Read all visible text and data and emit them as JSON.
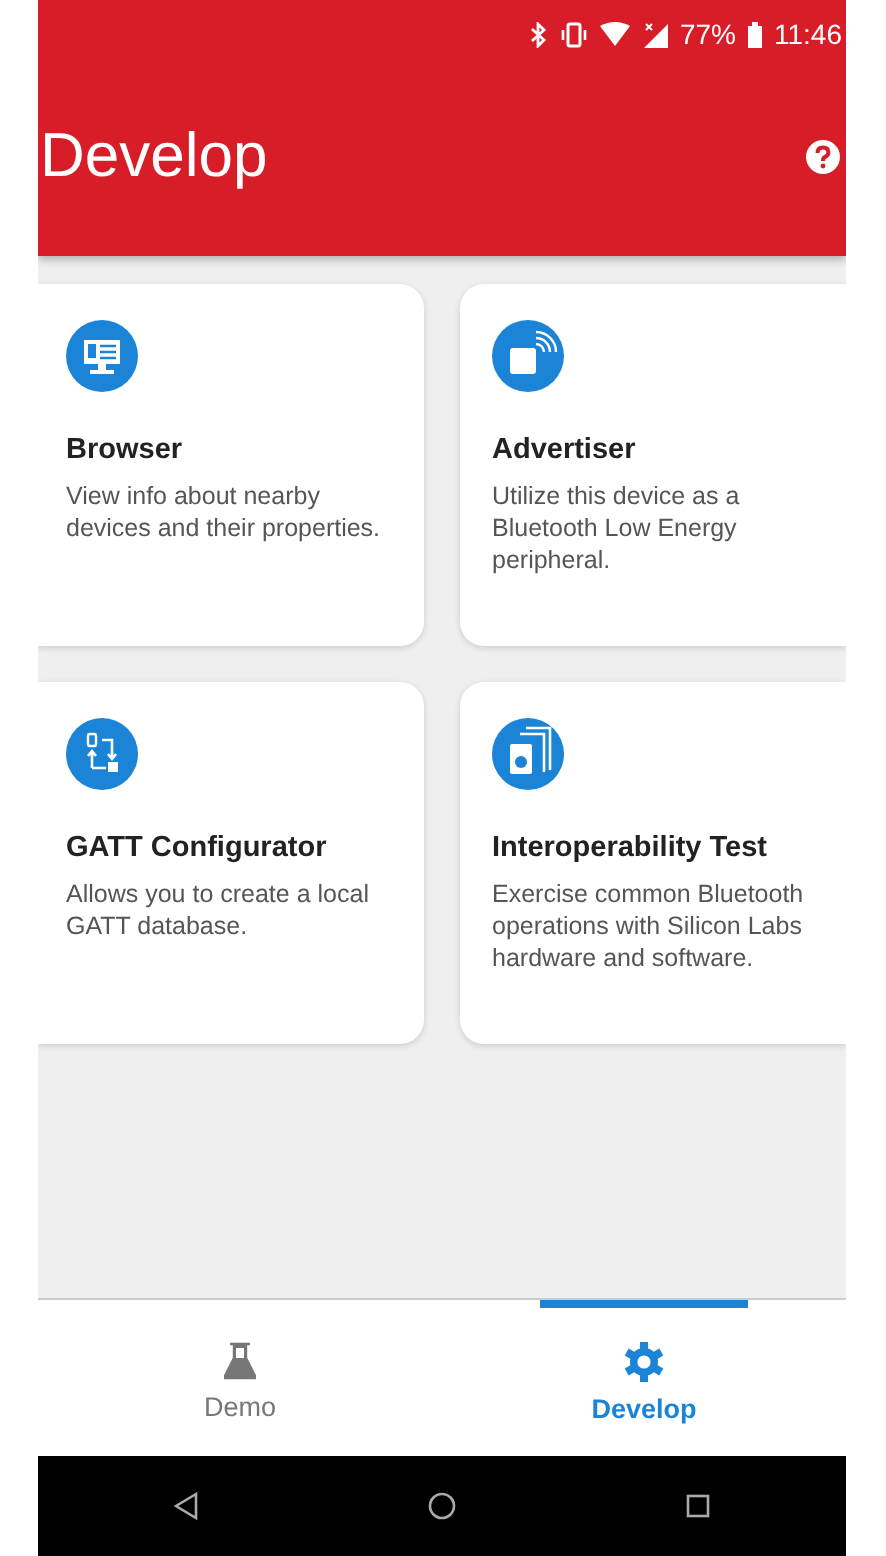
{
  "status_bar": {
    "battery": "77%",
    "time": "11:46"
  },
  "header": {
    "title": "Develop"
  },
  "cards": [
    {
      "title": "Browser",
      "description": "View info about nearby devices and their properties."
    },
    {
      "title": "Advertiser",
      "description": "Utilize this device as a Bluetooth Low Energy peripheral."
    },
    {
      "title": "GATT Configurator",
      "description": "Allows you to create a local GATT database."
    },
    {
      "title": "Interoperability Test",
      "description": "Exercise common Bluetooth operations with Silicon Labs hardware and software."
    }
  ],
  "bottom_nav": [
    {
      "label": "Demo",
      "selected": false
    },
    {
      "label": "Develop",
      "selected": true
    }
  ]
}
